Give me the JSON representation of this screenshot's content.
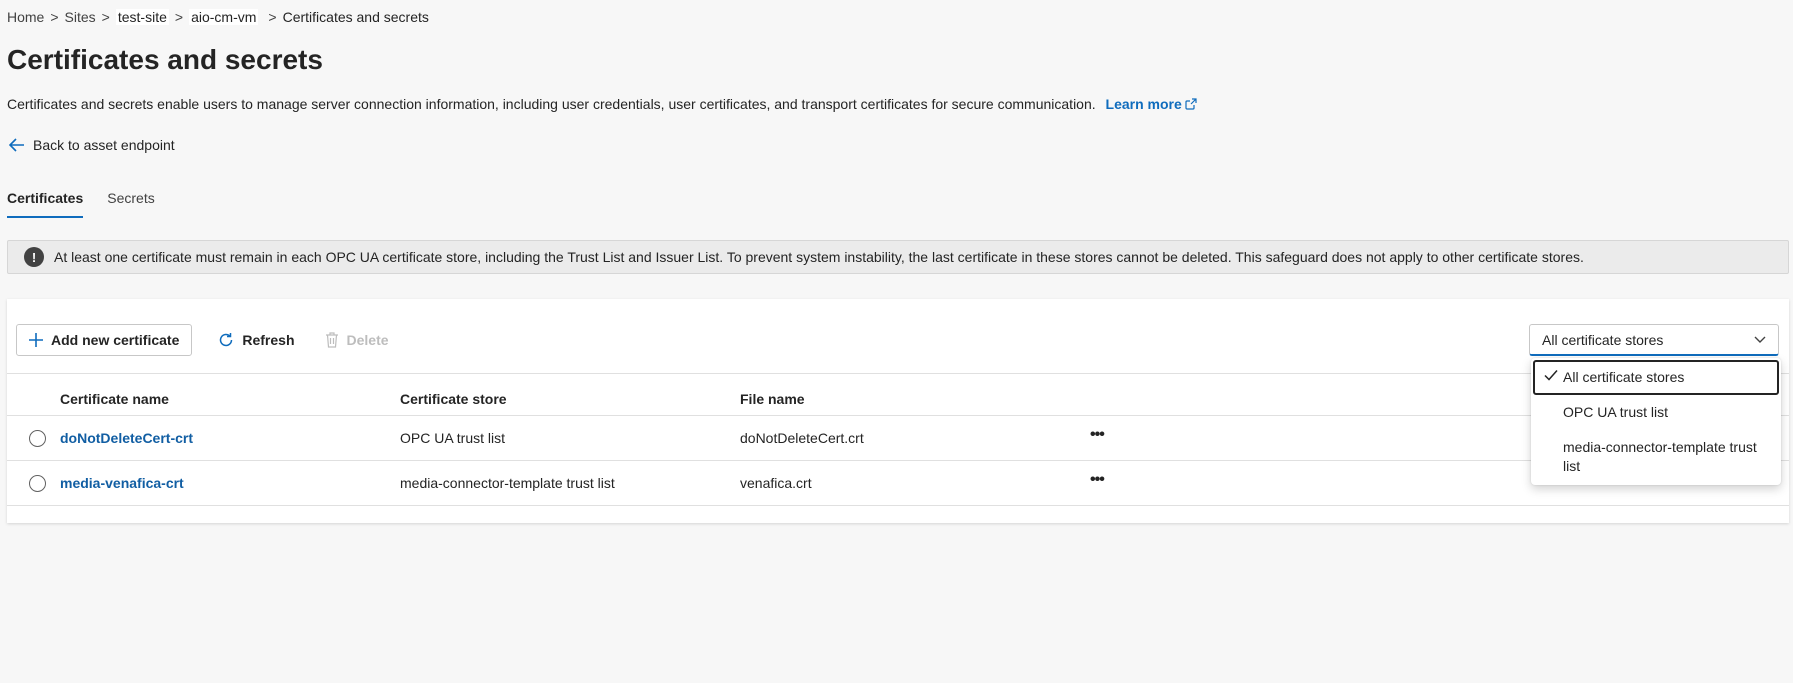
{
  "breadcrumb": {
    "items": [
      "Home",
      "Sites",
      "test-site",
      "aio-cm-vm",
      "Certificates and secrets"
    ],
    "separator": ">"
  },
  "page": {
    "title": "Certificates and secrets",
    "description": "Certificates and secrets enable users to manage server connection information, including user credentials, user certificates, and transport certificates for secure communication.",
    "learn_more": "Learn more",
    "back_label": "Back to asset endpoint"
  },
  "tabs": [
    {
      "label": "Certificates",
      "active": true
    },
    {
      "label": "Secrets",
      "active": false
    }
  ],
  "alert": {
    "icon": "!",
    "text": "At least one certificate must remain in each OPC UA certificate store, including the Trust List and Issuer List. To prevent system instability, the last certificate in these stores cannot be deleted. This safeguard does not apply to other certificate stores."
  },
  "toolbar": {
    "add_label": "Add new certificate",
    "refresh_label": "Refresh",
    "delete_label": "Delete"
  },
  "filter": {
    "selected": "All certificate stores",
    "options": [
      "All certificate stores",
      "OPC UA trust list",
      "media-connector-template trust list"
    ]
  },
  "table": {
    "columns": [
      "Certificate name",
      "Certificate store",
      "File name"
    ],
    "rows": [
      {
        "name": "doNotDeleteCert-crt",
        "store": "OPC UA trust list",
        "file": "doNotDeleteCert.crt",
        "more": "•••"
      },
      {
        "name": "media-venafica-crt",
        "store": "media-connector-template trust list",
        "file": "venafica.crt",
        "more": "•••"
      }
    ]
  },
  "colors": {
    "accent": "#0f6cbd",
    "link": "#115ea3",
    "background": "#f7f7f7"
  }
}
